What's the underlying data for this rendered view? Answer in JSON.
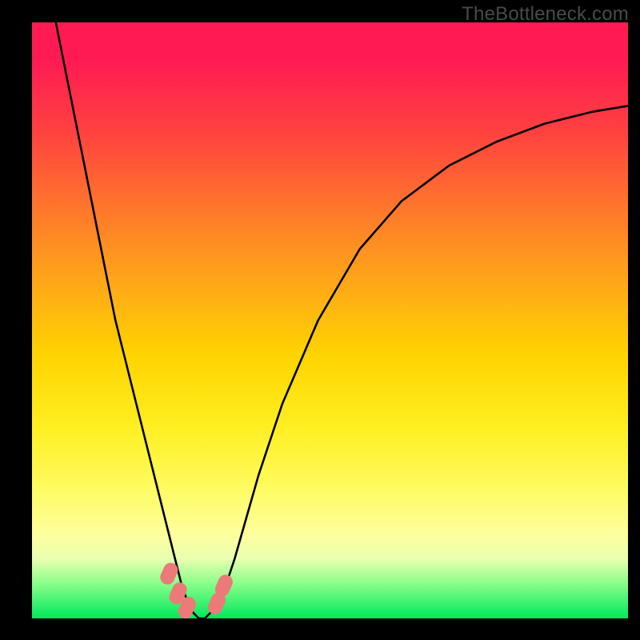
{
  "watermark": "TheBottleneck.com",
  "chart_data": {
    "type": "line",
    "title": "",
    "xlabel": "",
    "ylabel": "",
    "xlim": [
      0,
      100
    ],
    "ylim": [
      0,
      100
    ],
    "grid": false,
    "legend": false,
    "series": [
      {
        "name": "bottleneck-curve",
        "x": [
          4,
          6,
          8,
          10,
          12,
          14,
          16,
          18,
          20,
          22,
          24,
          25,
          26,
          27,
          28,
          29,
          30,
          32,
          34,
          38,
          42,
          48,
          55,
          62,
          70,
          78,
          86,
          94,
          100
        ],
        "y": [
          100,
          90,
          80,
          70,
          60,
          50,
          42,
          34,
          26,
          18,
          10,
          6,
          3,
          1,
          0,
          0,
          1,
          4,
          10,
          24,
          36,
          50,
          62,
          70,
          76,
          80,
          83,
          85,
          86
        ]
      }
    ],
    "markers": [
      {
        "name": "marker-left-1",
        "x": 23.0,
        "y": 7.5
      },
      {
        "name": "marker-left-2",
        "x": 24.5,
        "y": 4.2
      },
      {
        "name": "marker-left-3",
        "x": 26.0,
        "y": 1.8
      },
      {
        "name": "marker-right-1",
        "x": 31.0,
        "y": 2.5
      },
      {
        "name": "marker-right-2",
        "x": 32.2,
        "y": 5.5
      }
    ],
    "colors": {
      "curve": "#000000",
      "marker": "#ec7a78",
      "gradient_top": "#ff1a54",
      "gradient_mid": "#ffd400",
      "gradient_bottom": "#00e85b"
    }
  }
}
